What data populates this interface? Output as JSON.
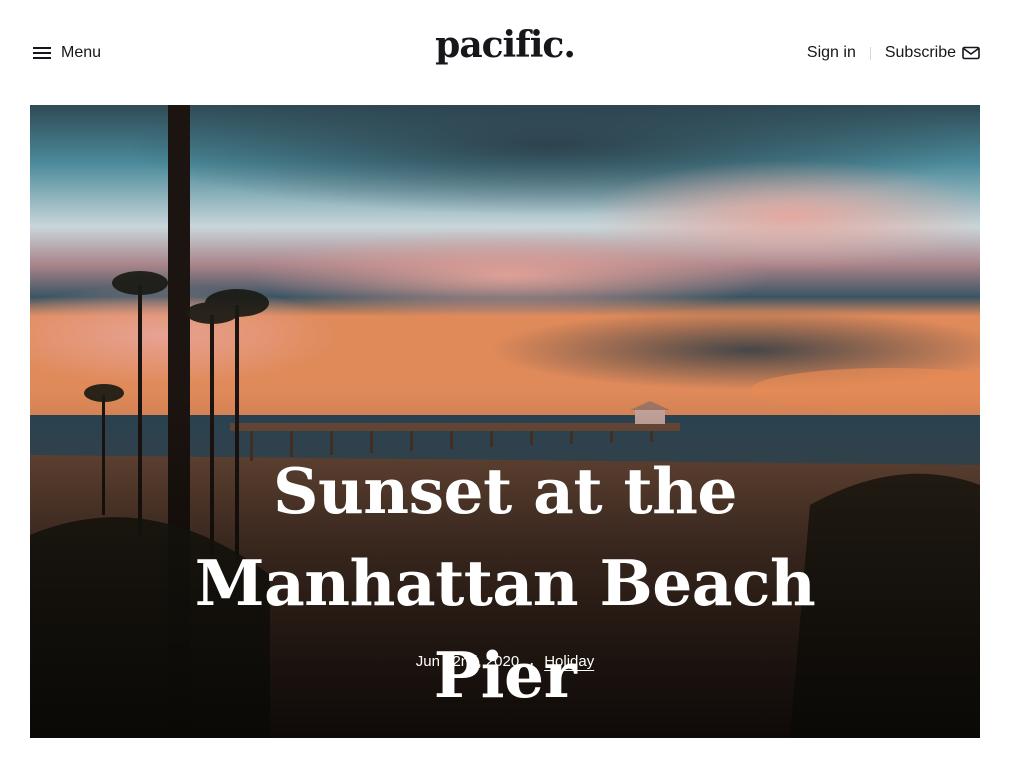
{
  "header": {
    "menu_label": "Menu",
    "logo": "pacific.",
    "signin_label": "Sign in",
    "subscribe_label": "Subscribe"
  },
  "hero": {
    "title": "Sunset at the Manhattan Beach Pier",
    "date": "Jun 22nd, 2020",
    "separator": ".",
    "tag": "Holiday"
  },
  "icons": {
    "menu": "hamburger-icon",
    "subscribe": "envelope-icon"
  },
  "colors": {
    "text": "#15171a",
    "background": "#ffffff",
    "hero_text": "#ffffff"
  }
}
